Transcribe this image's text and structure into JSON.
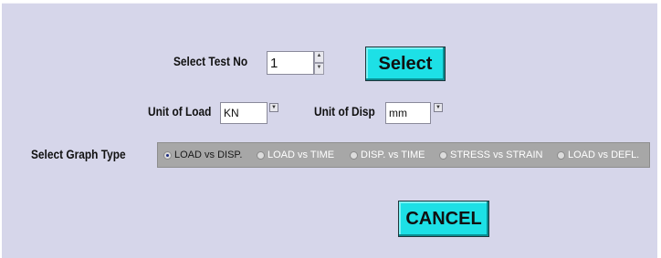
{
  "test": {
    "label": "Select Test No",
    "value": "1",
    "select_button": "Select"
  },
  "units": {
    "load_label": "Unit of Load",
    "load_value": "KN",
    "disp_label": "Unit of Disp",
    "disp_value": "mm"
  },
  "graph": {
    "label": "Select Graph Type",
    "selected": "LOAD vs DISP.",
    "options": [
      "LOAD vs DISP.",
      "LOAD vs TIME",
      "DISP. vs TIME",
      "STRESS vs STRAIN",
      "LOAD vs DEFL."
    ]
  },
  "actions": {
    "cancel_button": "CANCEL"
  },
  "colors": {
    "panel_bg": "#d6d6ea",
    "button_bg": "#1de0e6",
    "radio_strip_bg": "#a7a7a7"
  },
  "icons": {
    "spinner_up": "spinner-up-icon",
    "spinner_down": "spinner-down-icon",
    "dropdown": "dropdown-arrow-icon"
  }
}
